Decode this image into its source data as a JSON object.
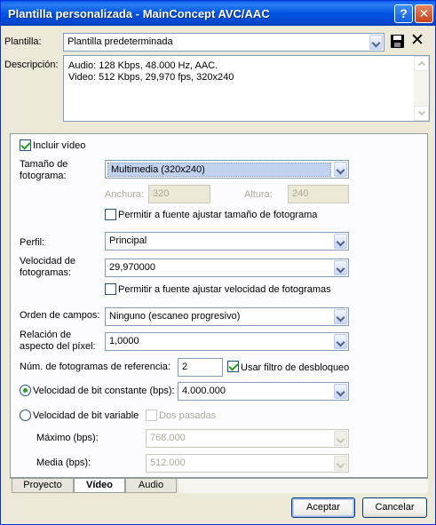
{
  "window": {
    "title": "Plantilla personalizada - MainConcept AVC/AAC",
    "help_label": "?",
    "close_label": "✕"
  },
  "template": {
    "label": "Plantilla:",
    "value": "Plantilla predeterminada",
    "delete_label": "✕"
  },
  "description": {
    "label": "Descripción:",
    "lines": [
      "Audio: 128 Kbps, 48.000 Hz, AAC.",
      "Video: 512 Kbps, 29,970 fps, 320x240"
    ]
  },
  "video": {
    "include_label": "Incluir vídeo",
    "include_checked": true,
    "frame_size": {
      "label_line1": "Tamaño de",
      "label_line2": "fotograma:",
      "value": "Multimedia (320x240)"
    },
    "width": {
      "label": "Anchura:",
      "value": "320"
    },
    "height": {
      "label": "Altura:",
      "value": "240"
    },
    "allow_resize_label": "Permitir a fuente ajustar tamaño de fotograma",
    "profile": {
      "label": "Perfil:",
      "value": "Principal"
    },
    "frame_rate": {
      "label_line1": "Velocidad de",
      "label_line2": "fotogramas:",
      "value": "29,970000"
    },
    "allow_rate_label": "Permitir a fuente ajustar velocidad de fotogramas",
    "field_order": {
      "label": "Orden de campos:",
      "value": "Ninguno (escaneo progresivo)"
    },
    "pixel_aspect": {
      "label_line1": "Relación de",
      "label_line2": "aspecto del píxel:",
      "value": "1,0000"
    },
    "ref_frames": {
      "label": "Núm. de fotogramas de referencia:",
      "value": "2"
    },
    "deblock": {
      "label": "Usar filtro de desbloqueo",
      "checked": true
    },
    "cbr": {
      "label": "Velocidad de bit constante (bps):",
      "value": "4.000.000",
      "selected": true
    },
    "vbr": {
      "label": "Velocidad de bit variable",
      "selected": false
    },
    "two_pass_label": "Dos pasadas",
    "max": {
      "label": "Máximo (bps):",
      "value": "768.000"
    },
    "avg": {
      "label": "Media (bps):",
      "value": "512.000"
    }
  },
  "tabs": [
    "Proyecto",
    "Vídeo",
    "Audio"
  ],
  "active_tab": "Vídeo",
  "buttons": {
    "accept": "Aceptar",
    "cancel": "Cancelar"
  }
}
